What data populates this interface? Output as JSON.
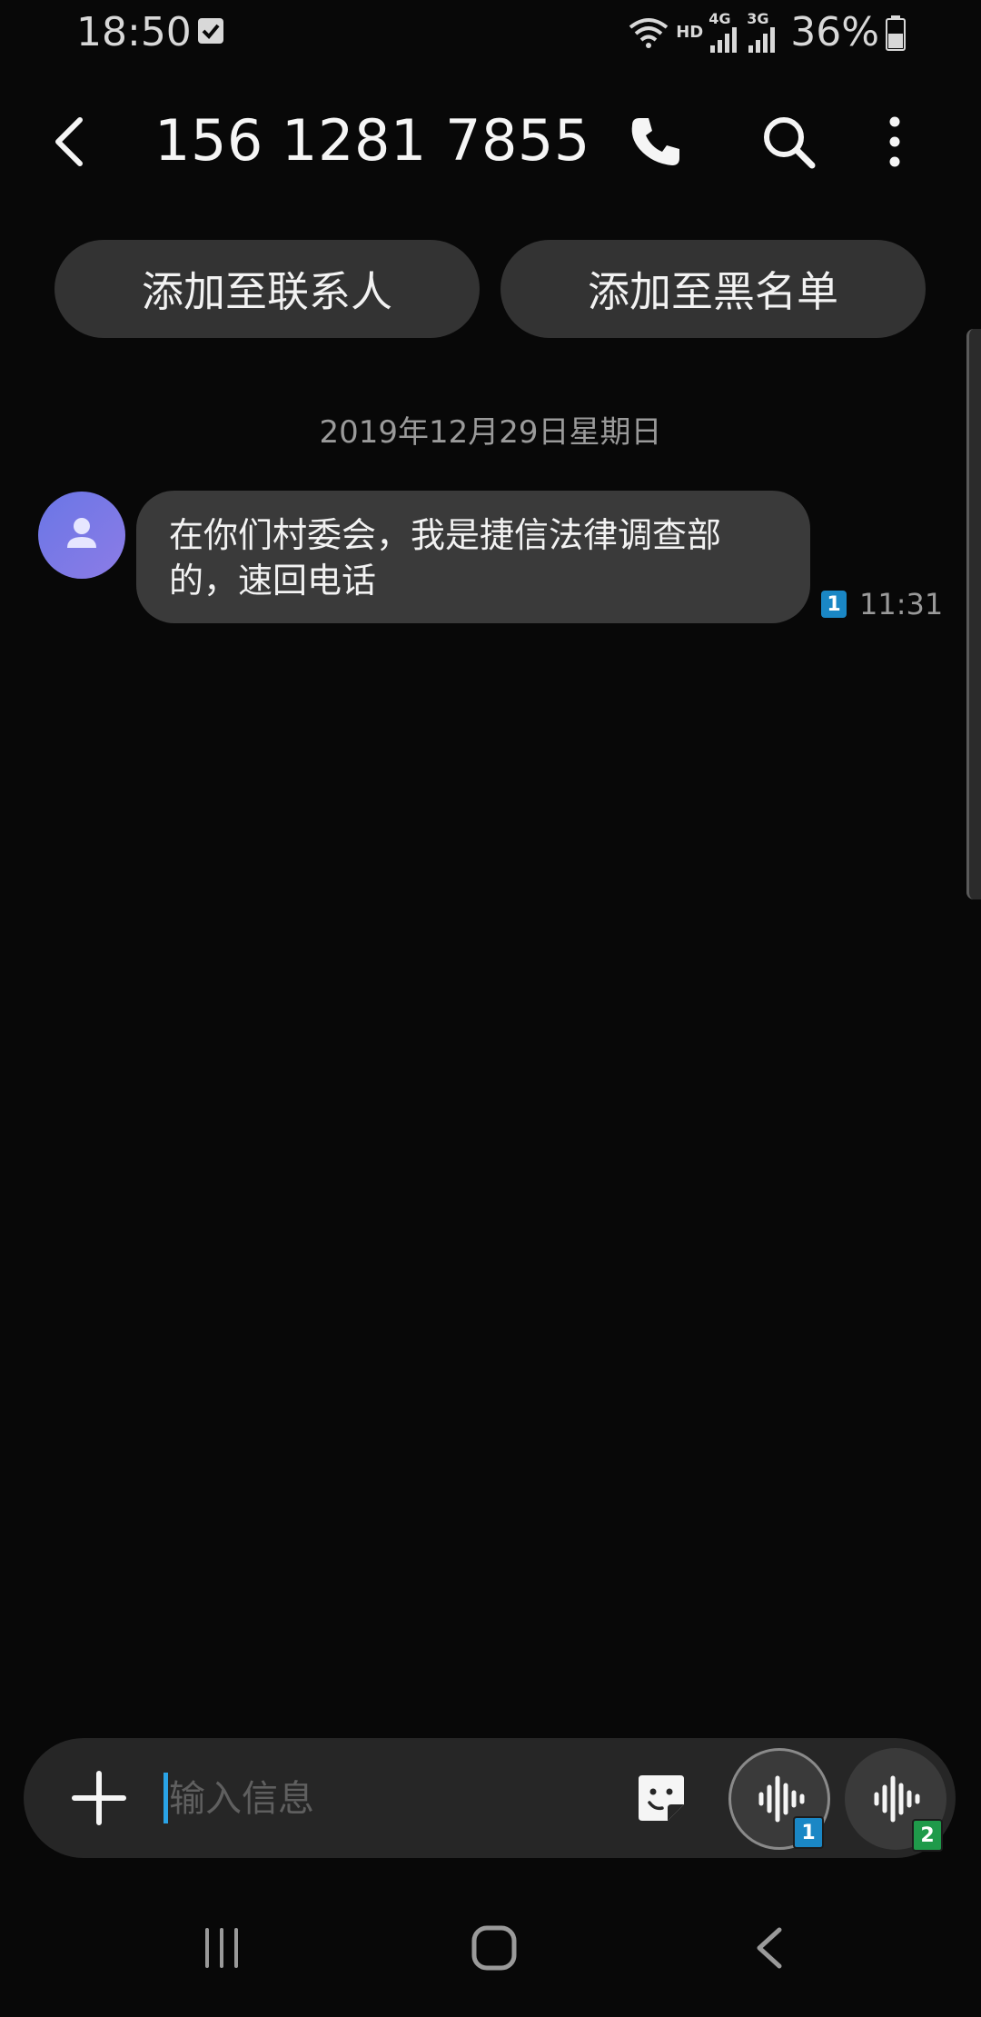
{
  "status_bar": {
    "time": "18:50",
    "hd": "HD",
    "net1": "4G",
    "net2": "3G",
    "battery": "36%"
  },
  "header": {
    "title": "156 1281 7855"
  },
  "actions": {
    "add_contact": "添加至联系人",
    "block": "添加至黑名单"
  },
  "conversation": {
    "date": "2019年12月29日星期日",
    "messages": [
      {
        "text": "在你们村委会，我是捷信法律调查部的，速回电话",
        "sim": "1",
        "time": "11:31"
      }
    ]
  },
  "compose": {
    "placeholder": "输入信息",
    "voice_sims": [
      "1",
      "2"
    ]
  },
  "colors": {
    "background": "#080808",
    "bubble": "#3a3a3a",
    "pill": "#333333",
    "sim1": "#1a87c5",
    "sim2": "#1f9a4a",
    "cursor": "#2aa3e6"
  },
  "icons": [
    "check-icon",
    "wifi-icon",
    "signal-icon",
    "battery-icon",
    "back-arrow-icon",
    "phone-icon",
    "search-icon",
    "more-vertical-icon",
    "person-icon",
    "plus-icon",
    "sticker-icon",
    "voice-wave-icon",
    "recents-icon",
    "home-icon",
    "back-icon"
  ]
}
